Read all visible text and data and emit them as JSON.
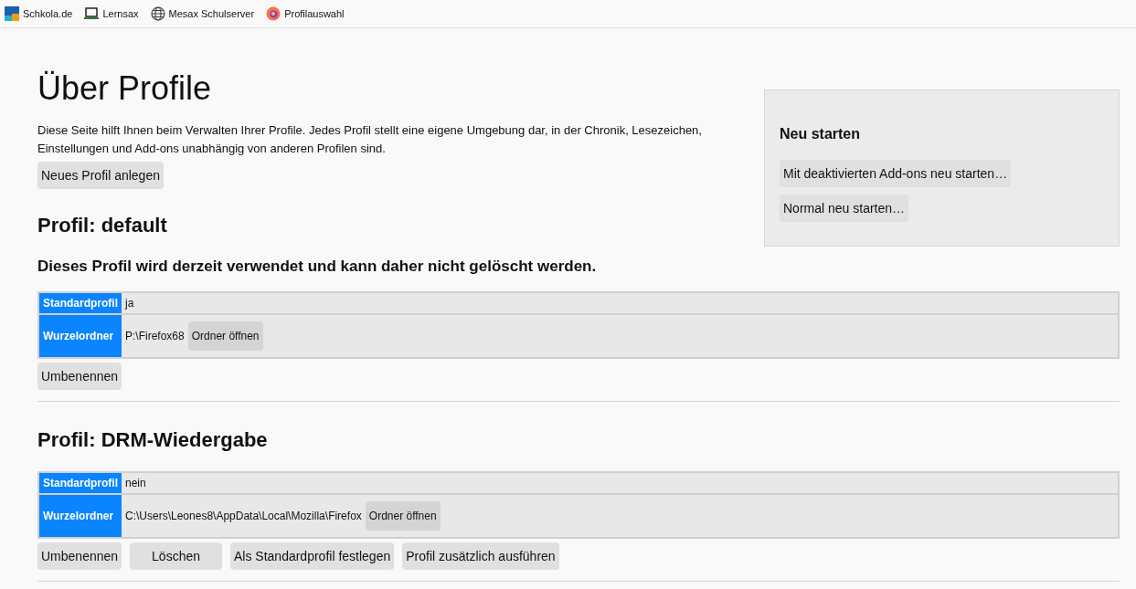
{
  "bookmarks": [
    {
      "label": "Schkola.de",
      "kind": "logo"
    },
    {
      "label": "Lernsax",
      "kind": "laptop"
    },
    {
      "label": "Mesax Schulserver",
      "kind": "globe"
    },
    {
      "label": "Profilauswahl",
      "kind": "firefox"
    }
  ],
  "title": "Über Profile",
  "intro": "Diese Seite hilft Ihnen beim Verwalten Ihrer Profile. Jedes Profil stellt eine eigene Umgebung dar, in der Chronik, Lesezeichen, Einstellungen und Add-ons unabhängig von anderen Profilen sind.",
  "new_profile_button": "Neues Profil anlegen",
  "restart_panel": {
    "heading": "Neu starten",
    "buttons": [
      "Mit deaktivierten Add-ons neu starten…",
      "Normal neu starten…"
    ]
  },
  "profiles": [
    {
      "heading": "Profil: default",
      "notice": "Dieses Profil wird derzeit verwendet und kann daher nicht gelöscht werden.",
      "rows": [
        {
          "label": "Standardprofil",
          "value": "ja"
        },
        {
          "label": "Wurzelordner",
          "value": "P:\\Firefox68",
          "button": "Ordner öffnen"
        }
      ],
      "buttons": [
        "Umbenennen"
      ]
    },
    {
      "heading": "Profil: DRM-Wiedergabe",
      "rows": [
        {
          "label": "Standardprofil",
          "value": "nein"
        },
        {
          "label": "Wurzelordner",
          "value": "C:\\Users\\Leones8\\AppData\\Local\\Mozilla\\Firefox",
          "button": "Ordner öffnen"
        }
      ],
      "buttons": [
        "Umbenennen",
        "Löschen",
        "Als Standardprofil festlegen",
        "Profil zusätzlich ausführen"
      ]
    }
  ]
}
